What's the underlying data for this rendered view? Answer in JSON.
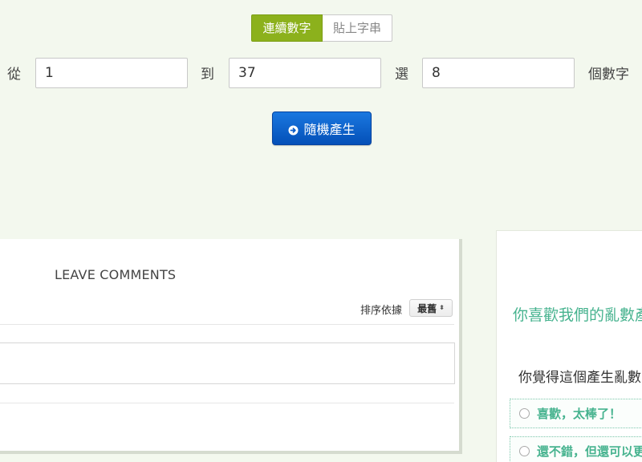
{
  "mode_toggle": {
    "active_label": "連續數字",
    "inactive_label": "貼上字串"
  },
  "range": {
    "from_label": "從",
    "from_value": "1",
    "to_label": "到",
    "to_value": "37",
    "pick_label": "選",
    "pick_value": "8",
    "count_label": "個數字"
  },
  "generate_button": {
    "label": "隨機產生",
    "icon": "arrow-circle-right-icon"
  },
  "comments": {
    "title": "LEAVE COMMENTS",
    "sort_label": "排序依據",
    "sort_value": "最舊"
  },
  "poll": {
    "title": "你喜歡我們的亂數產生器嗎",
    "question": "你覺得這個產生亂數的工具",
    "options": [
      {
        "label": "喜歡，太棒了！"
      },
      {
        "label": "還不錯，但還可以更好"
      }
    ]
  },
  "colors": {
    "background": "#f3f8ee",
    "toggle_active": "#8cb11c",
    "button_blue": "#0a62cc",
    "poll_green": "#47b38f"
  }
}
